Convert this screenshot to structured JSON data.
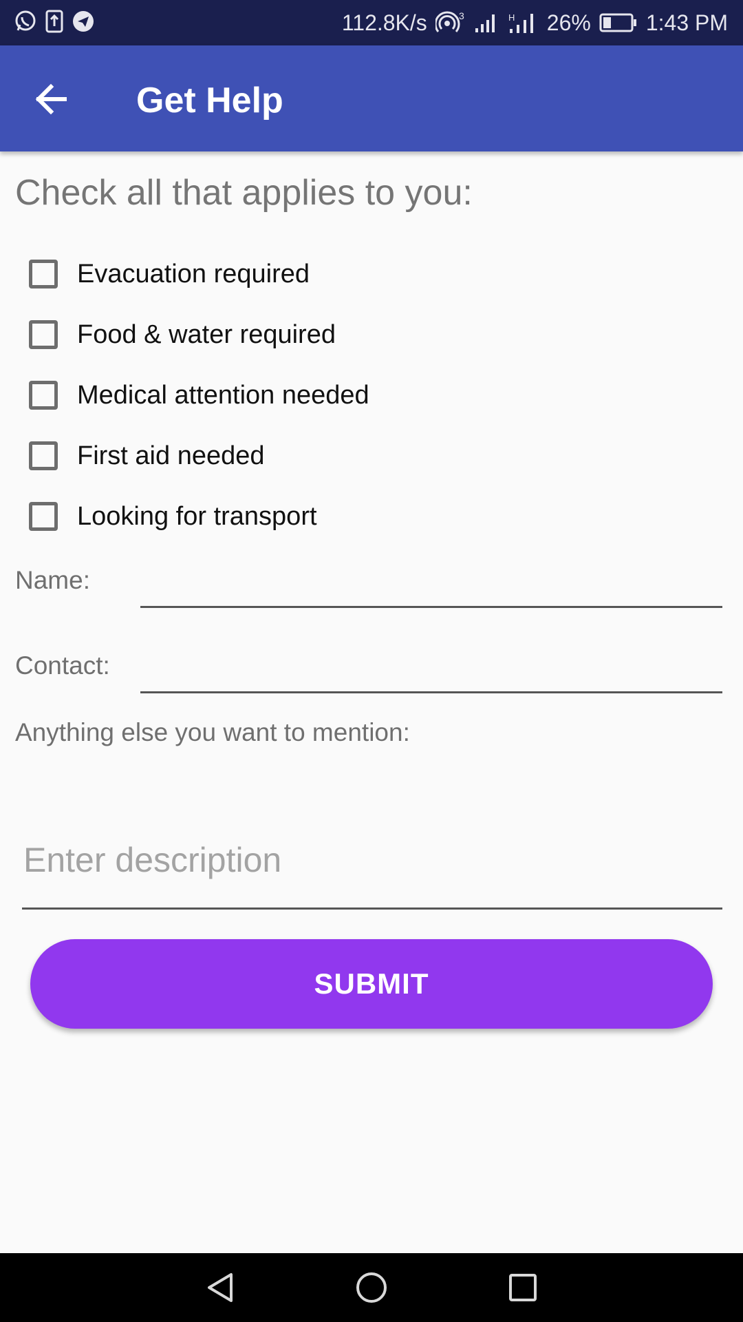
{
  "status_bar": {
    "network_speed": "112.8K/s",
    "hotspot_count": "3",
    "battery": "26%",
    "time": "1:43 PM",
    "icons": [
      "whatsapp-icon",
      "upload-icon",
      "telegram-icon",
      "hotspot-icon",
      "signal-icon",
      "signal-h-icon",
      "battery-icon"
    ]
  },
  "app_bar": {
    "title": "Get Help",
    "background": "#3f51b5",
    "back_icon": "arrow-back-icon"
  },
  "form": {
    "heading": "Check all that applies to you:",
    "checkboxes": [
      {
        "label": "Evacuation required",
        "checked": false
      },
      {
        "label": "Food & water required",
        "checked": false
      },
      {
        "label": "Medical attention needed",
        "checked": false
      },
      {
        "label": "First aid needed",
        "checked": false
      },
      {
        "label": "Looking for transport",
        "checked": false
      }
    ],
    "name_label": "Name:",
    "name_value": "",
    "contact_label": "Contact:",
    "contact_value": "",
    "mention_label": "Anything else you want to mention:",
    "description_placeholder": "Enter description",
    "description_value": "",
    "submit_label": "SUBMIT",
    "submit_color": "#9138ee"
  },
  "nav_bar": {
    "icons": [
      "back-triangle-icon",
      "home-circle-icon",
      "recents-square-icon"
    ]
  }
}
